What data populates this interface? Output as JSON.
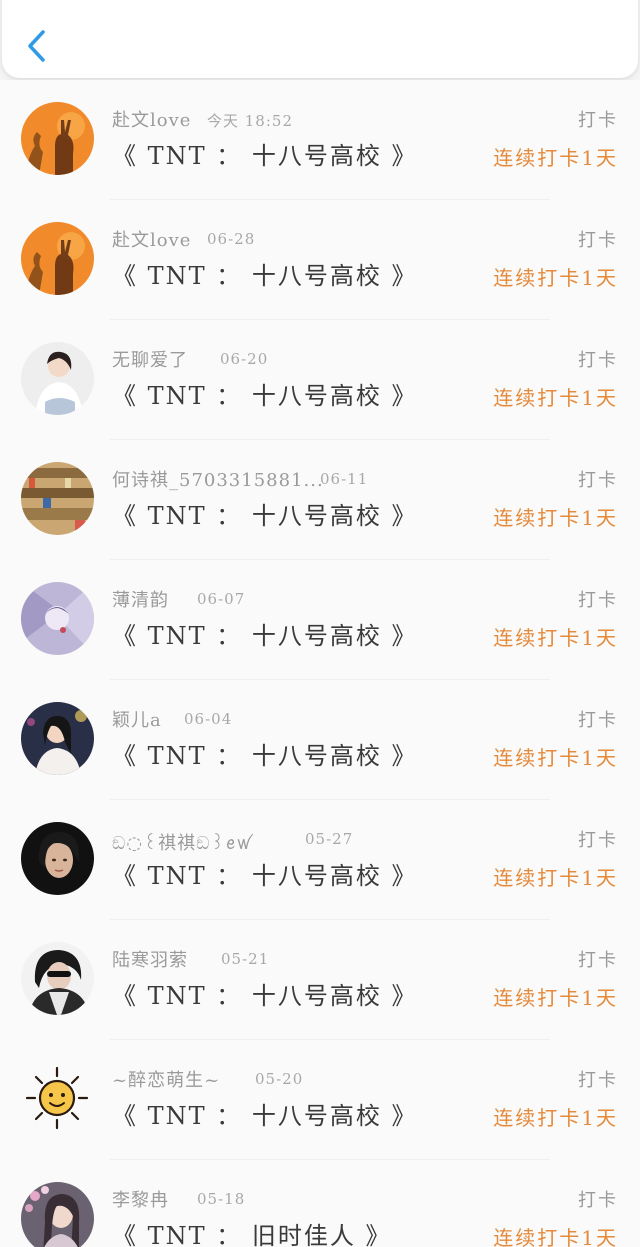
{
  "header": {
    "back_icon": "chevron-left-icon",
    "accent": "#2f9be6"
  },
  "colors": {
    "streak": "#e5893a",
    "meta": "#9a9a9a"
  },
  "entries": [
    {
      "name": "赴文love",
      "date": "今天 18:52",
      "book": "《 TNT ： 十八号高校 》",
      "checkin": "打卡",
      "streak": "连续打卡1天"
    },
    {
      "name": "赴文love",
      "date": "06-28",
      "book": "《 TNT ： 十八号高校 》",
      "checkin": "打卡",
      "streak": "连续打卡1天"
    },
    {
      "name": "无聊爱了",
      "date": "06-20",
      "book": "《 TNT ： 十八号高校 》",
      "checkin": "打卡",
      "streak": "连续打卡1天"
    },
    {
      "name": "何诗祺_5703315881...",
      "date": "06-11",
      "book": "《 TNT ： 十八号高校 》",
      "checkin": "打卡",
      "streak": "连续打卡1天"
    },
    {
      "name": "薄清韵",
      "date": "06-07",
      "book": "《 TNT ： 十八号高校 》",
      "checkin": "打卡",
      "streak": "连续打卡1天"
    },
    {
      "name": "颖儿a",
      "date": "06-04",
      "book": "《 TNT ： 十八号高校 》",
      "checkin": "打卡",
      "streak": "连续打卡1天"
    },
    {
      "name": "ඞ◌꒰祺祺ඞ꒱ꫀꪝ",
      "date": "05-27",
      "book": "《 TNT ： 十八号高校 》",
      "checkin": "打卡",
      "streak": "连续打卡1天"
    },
    {
      "name": "陆寒羽萦",
      "date": "05-21",
      "book": "《 TNT ： 十八号高校 》",
      "checkin": "打卡",
      "streak": "连续打卡1天"
    },
    {
      "name": "~醉恋萌生~",
      "date": "05-20",
      "book": "《 TNT ： 十八号高校 》",
      "checkin": "打卡",
      "streak": "连续打卡1天"
    },
    {
      "name": "李黎冉",
      "date": "05-18",
      "book": "《 TNT ： 旧时佳人 》",
      "checkin": "打卡",
      "streak": "连续打卡1天"
    }
  ]
}
